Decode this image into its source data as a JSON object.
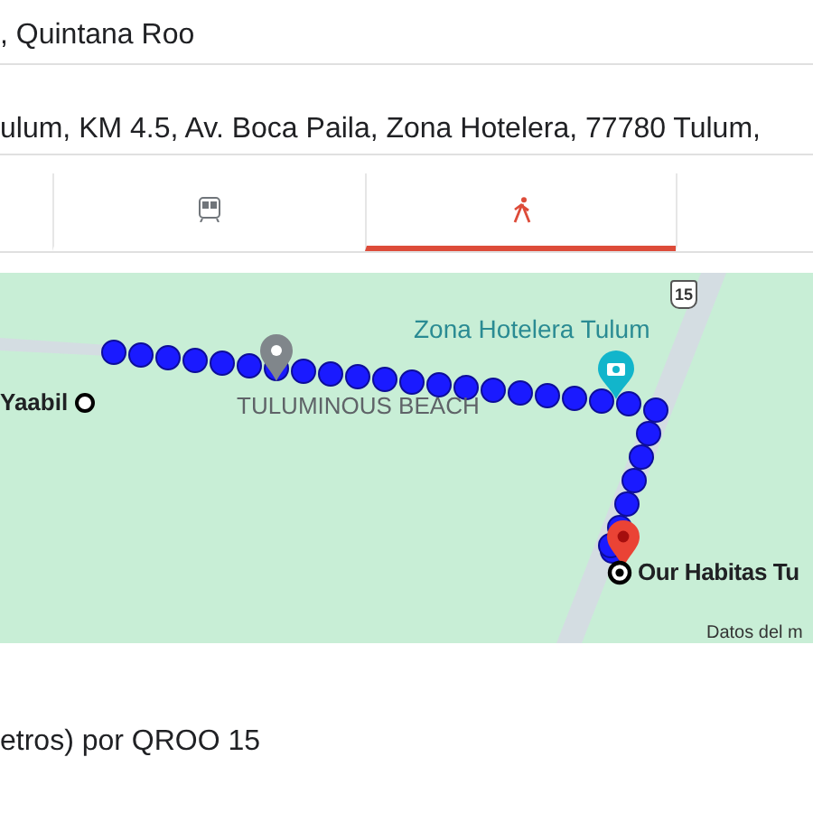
{
  "origin": {
    "value": ", Quintana Roo"
  },
  "destination": {
    "value": "ulum, KM 4.5, Av. Boca Paila, Zona Hotelera, 77780 Tulum,"
  },
  "tabs": [
    {
      "kind": "blank",
      "selected": false
    },
    {
      "kind": "transit",
      "selected": false
    },
    {
      "kind": "walk",
      "selected": true
    },
    {
      "kind": "blank",
      "selected": false
    }
  ],
  "map": {
    "route_shield": "15",
    "labels": [
      {
        "kind": "area",
        "text": "Zona Hotelera Tulum"
      },
      {
        "kind": "start",
        "text": "Yaabil"
      },
      {
        "kind": "poi",
        "text": "TULUMINOUS BEACH"
      },
      {
        "kind": "end",
        "text": "Our Habitas Tu"
      },
      {
        "kind": "attribution",
        "text": "Datos del m"
      }
    ]
  },
  "route_summary": "etros) por QROO 15"
}
